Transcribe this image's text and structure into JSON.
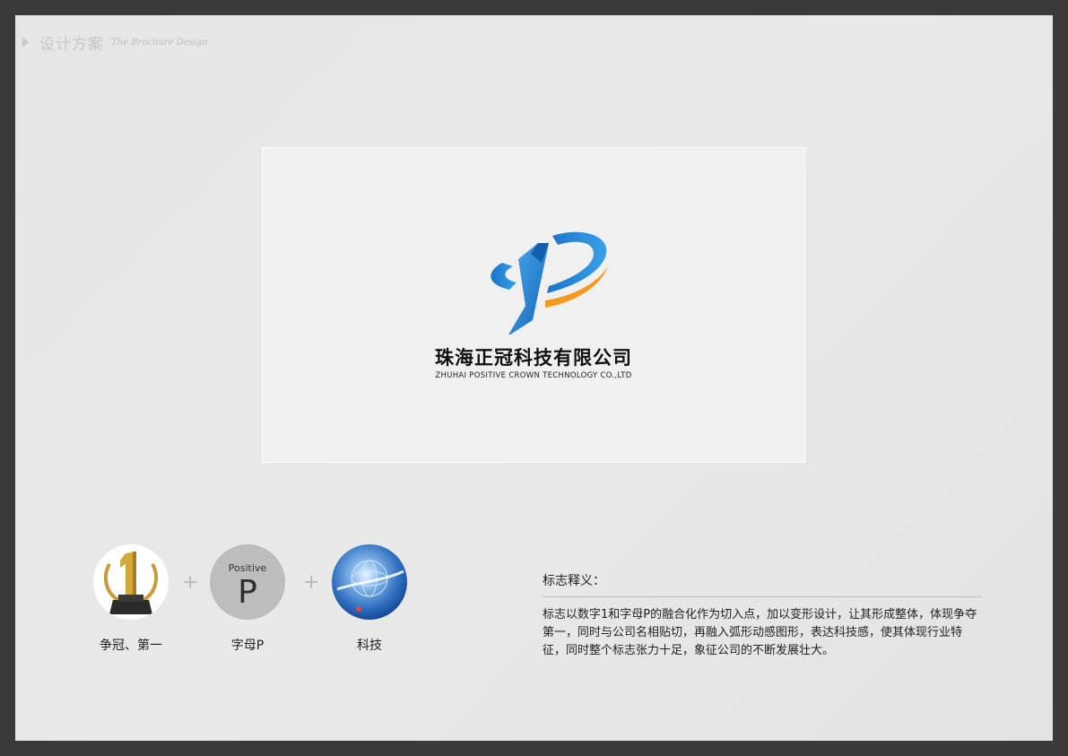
{
  "header": {
    "title": "设计方案",
    "subtitle": "The Brochure Design"
  },
  "logo": {
    "company_cn": "珠海正冠科技有限公司",
    "company_en": "ZHUHAI POSITIVE CROWN TECHNOLOGY CO.,LTD",
    "colors": {
      "primary_blue": "#1f86d6",
      "dark_blue": "#0f5fae",
      "accent_orange": "#f39a1e"
    }
  },
  "concepts": {
    "items": [
      {
        "icon": "trophy-number-one-icon",
        "caption": "争冠、第一"
      },
      {
        "icon": "letter-p-icon",
        "badge_text": "Positive",
        "letter": "P",
        "caption": "字母P"
      },
      {
        "icon": "tech-globe-icon",
        "caption": "科技"
      }
    ],
    "plus_symbol": "+"
  },
  "explanation": {
    "title": "标志释义：",
    "body": "标志以数字1和字母P的融合化作为切入点，加以变形设计，让其形成整体，体现争夺第一，同时与公司名相贴切，再融入弧形动感图形，表达科技感，使其体现行业特征，同时整个标志张力十足，象征公司的不断发展壮大。"
  }
}
